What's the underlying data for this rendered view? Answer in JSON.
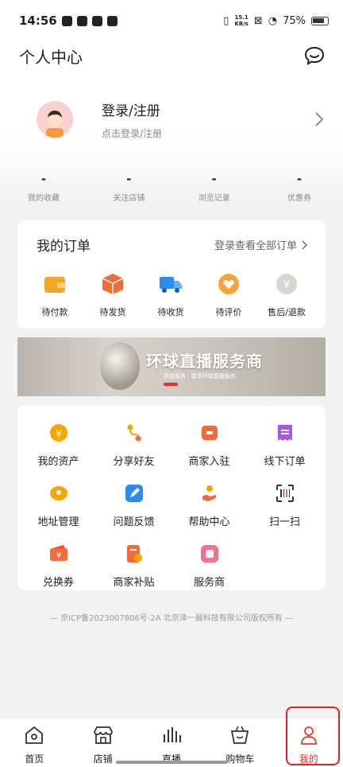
{
  "status_bar": {
    "time": "14:56",
    "speed_value": "15.1",
    "speed_unit": "KB/s",
    "battery": "75%"
  },
  "header": {
    "title": "个人中心"
  },
  "profile": {
    "title": "登录/注册",
    "subtitle": "点击登录/注册"
  },
  "stats": [
    {
      "value": "-",
      "label": "我的收藏"
    },
    {
      "value": "-",
      "label": "关注店铺"
    },
    {
      "value": "-",
      "label": "浏览记录"
    },
    {
      "value": "-",
      "label": "优惠券"
    }
  ],
  "orders": {
    "title": "我的订单",
    "link": "登录查看全部订单",
    "items": [
      {
        "label": "待付款",
        "icon": "wallet-icon",
        "color": "#f5a623"
      },
      {
        "label": "待发货",
        "icon": "package-icon",
        "color": "#f26b3a"
      },
      {
        "label": "待收货",
        "icon": "truck-icon",
        "color": "#2a8cf0"
      },
      {
        "label": "待评价",
        "icon": "heart-icon",
        "color": "#f8a23a"
      },
      {
        "label": "售后/退款",
        "icon": "refund-icon",
        "color": "#c9c5bf"
      }
    ]
  },
  "banner": {
    "title": "环球直播服务商",
    "subtitle": "高级服务 · 尊享环球直播服务"
  },
  "services": [
    {
      "label": "我的资产",
      "icon": "assets-icon",
      "color": "#f7a600"
    },
    {
      "label": "分享好友",
      "icon": "share-icon",
      "color": "#f7a600"
    },
    {
      "label": "商家入驻",
      "icon": "merchant-icon",
      "color": "#f26b3a"
    },
    {
      "label": "线下订单",
      "icon": "offline-order-icon",
      "color": "#a35bd9"
    },
    {
      "label": "地址管理",
      "icon": "address-icon",
      "color": "#f7a600"
    },
    {
      "label": "问题反馈",
      "icon": "feedback-icon",
      "color": "#2a8cf0"
    },
    {
      "label": "帮助中心",
      "icon": "help-icon",
      "color": "#f26b3a"
    },
    {
      "label": "扫一扫",
      "icon": "scan-icon",
      "color": "#333333"
    },
    {
      "label": "兑换券",
      "icon": "coupon-icon",
      "color": "#f26b3a"
    },
    {
      "label": "商家补贴",
      "icon": "subsidy-icon",
      "color": "#f26b3a"
    },
    {
      "label": "服务商",
      "icon": "service-provider-icon",
      "color": "#f36f8a"
    }
  ],
  "icp": "— 京ICP备2023007806号-2A 北京泽一晨科技有限公司版权所有 —",
  "tabbar": [
    {
      "label": "首页",
      "icon": "home-icon"
    },
    {
      "label": "店铺",
      "icon": "store-icon"
    },
    {
      "label": "直播",
      "icon": "live-icon"
    },
    {
      "label": "购物车",
      "icon": "cart-icon"
    },
    {
      "label": "我的",
      "icon": "profile-icon",
      "active": true
    }
  ],
  "colors": {
    "accent": "#e63c2c",
    "highlight": "#d9232d"
  }
}
